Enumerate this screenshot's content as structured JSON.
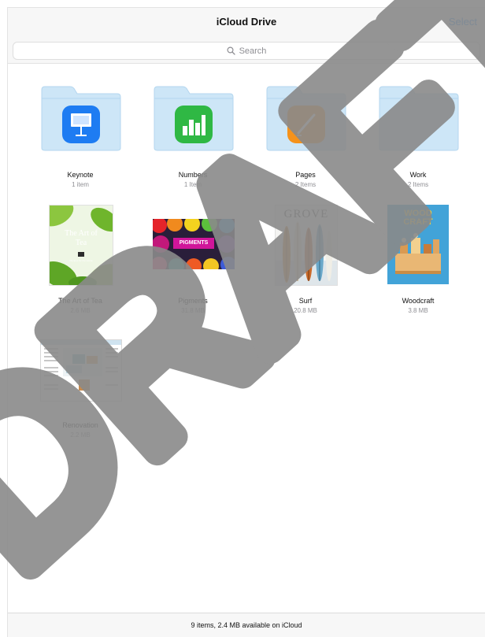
{
  "header": {
    "title": "iCloud Drive",
    "select_label": "Select"
  },
  "search": {
    "placeholder": "Search"
  },
  "items": [
    {
      "name": "Keynote",
      "meta": "1 item",
      "kind": "folder",
      "app_icon": "keynote-icon",
      "app_color": "#1e7cf2"
    },
    {
      "name": "Numbers",
      "meta": "1 Item",
      "kind": "folder",
      "app_icon": "numbers-icon",
      "app_color": "#2fb844"
    },
    {
      "name": "Pages",
      "meta": "2 Items",
      "kind": "folder",
      "app_icon": "pages-icon",
      "app_color": "#f5921b"
    },
    {
      "name": "Work",
      "meta": "2 Items",
      "kind": "folder",
      "app_icon": "",
      "app_color": ""
    },
    {
      "name": "The Art of Tea",
      "meta": "2.6 MB",
      "kind": "document",
      "cover_title": "The Art of Tea",
      "cover_subtitle": "Recipes for the Home"
    },
    {
      "name": "Pigments",
      "meta": "31.8 MB",
      "kind": "document",
      "cover_title": "PIGMENTS"
    },
    {
      "name": "Surf",
      "meta": "20.8 MB",
      "kind": "document",
      "cover_title": "GROVE"
    },
    {
      "name": "Woodcraft",
      "meta": "3.8 MB",
      "kind": "document",
      "cover_title": "WOOD CRAFT"
    },
    {
      "name": "Renovation",
      "meta": "2.2 MB",
      "kind": "document"
    }
  ],
  "footer": {
    "status": "9 items, 2.4 MB available on iCloud"
  },
  "watermark": {
    "text": "DRAFT"
  },
  "colors": {
    "accent": "#1a8cff",
    "folder": "#cde6f7"
  }
}
